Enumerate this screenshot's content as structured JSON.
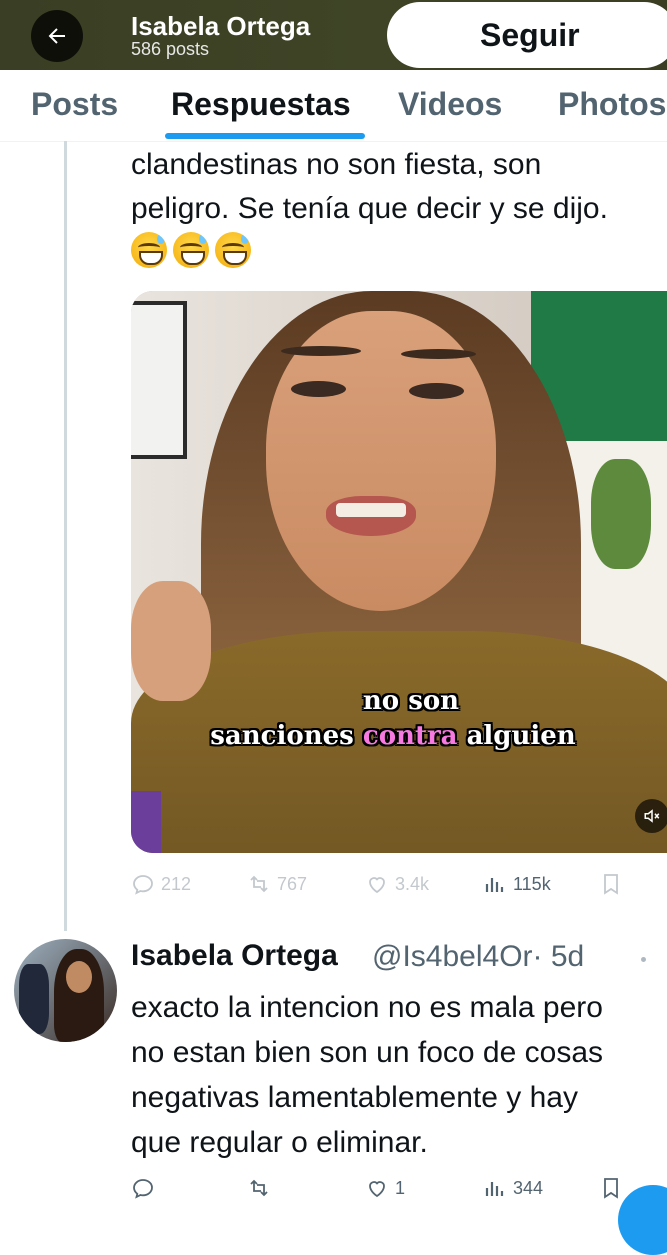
{
  "header": {
    "name": "Isabela Ortega",
    "post_count": "586 posts",
    "follow_label": "Seguir",
    "back_icon": "arrow-left-icon"
  },
  "tabs": [
    {
      "label": "Posts",
      "active": false
    },
    {
      "label": "Respuestas",
      "active": true
    },
    {
      "label": "Videos",
      "active": false
    },
    {
      "label": "Photos",
      "active": false
    }
  ],
  "tweet1": {
    "text_lines": [
      "clandestinas no son fiesta, son",
      "peligro. Se tenía que decir y se dijo."
    ],
    "emojis": [
      "grinning-sweat-emoji",
      "grinning-sweat-emoji",
      "grinning-sweat-emoji"
    ],
    "media": {
      "caption_line1": "no son",
      "caption_line2_a": "sanciones ",
      "caption_line2_b": "contra",
      "caption_line2_c": " alguien",
      "mute_icon": "volume-muted-icon"
    },
    "actions": {
      "replies": "212",
      "reposts": "767",
      "likes": "3.4k",
      "views": "115k"
    }
  },
  "tweet2": {
    "name": "Isabela Ortega",
    "handle": "@Is4bel4Or",
    "time": "· 5d",
    "text_lines": [
      "exacto la intencion no es mala pero",
      "no estan bien son un foco de cosas",
      "negativas lamentablemente y hay",
      "que regular o eliminar."
    ],
    "actions": {
      "likes": "1",
      "views": "344"
    }
  },
  "colors": {
    "accent": "#1d9bf0",
    "header_bg": "#3f4426",
    "secondary_text": "#536471"
  }
}
